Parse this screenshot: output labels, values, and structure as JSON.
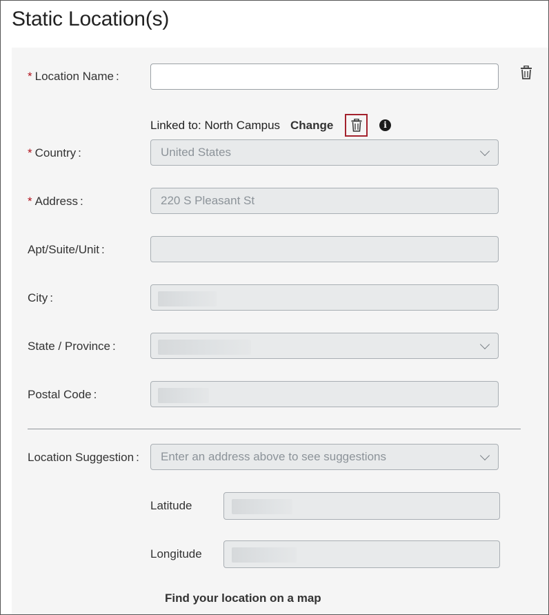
{
  "page": {
    "title": "Static Location(s)"
  },
  "form": {
    "location_name": {
      "label": "Location Name",
      "required": true,
      "value": "",
      "placeholder": ""
    },
    "linked": {
      "text": "Linked to: North Campus",
      "change_label": "Change"
    },
    "country": {
      "label": "Country",
      "required": true,
      "value": "United States"
    },
    "address": {
      "label": "Address",
      "required": true,
      "value": "220 S Pleasant St"
    },
    "apt": {
      "label": "Apt/Suite/Unit",
      "required": false,
      "value": ""
    },
    "city": {
      "label": "City",
      "required": false,
      "value": ""
    },
    "state": {
      "label": "State / Province",
      "required": false,
      "value": ""
    },
    "postal": {
      "label": "Postal Code",
      "required": false,
      "value": ""
    },
    "suggestion": {
      "label": "Location Suggestion",
      "placeholder": "Enter an address above to see suggestions"
    },
    "latitude": {
      "label": "Latitude",
      "value": ""
    },
    "longitude": {
      "label": "Longitude",
      "value": ""
    },
    "map_link": "Find your location on a map"
  },
  "icons": {
    "delete_location": "trash-icon",
    "unlink": "trash-icon",
    "info": "info-icon",
    "dropdown": "chevron-down-icon"
  },
  "colors": {
    "required": "#b1121c",
    "highlight_border": "#a3212c",
    "disabled_field_bg": "#e8eaeb",
    "panel_bg": "#f5f5f5"
  }
}
